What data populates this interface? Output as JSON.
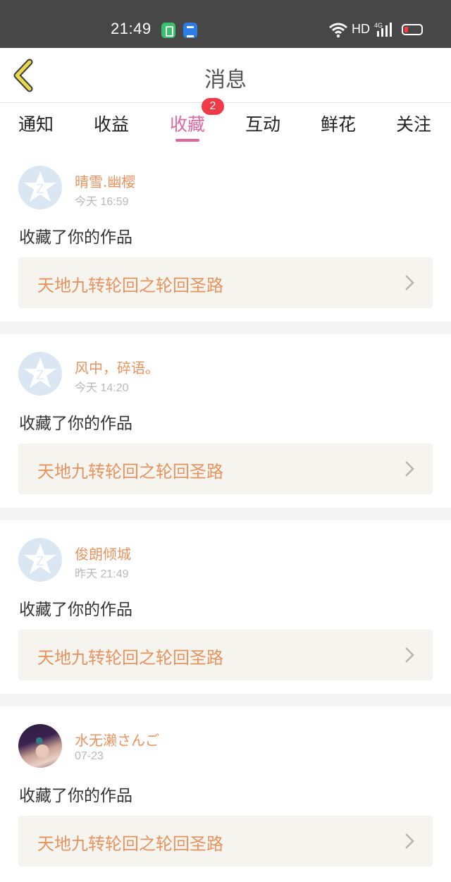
{
  "status_bar": {
    "time": "21:49",
    "network_label": "HD",
    "signal_label": "4G",
    "icons": [
      "app-green-icon",
      "app-blue-icon",
      "wifi-icon",
      "signal-icon",
      "battery-low-icon"
    ],
    "battery_color": "#ff3b3b"
  },
  "header": {
    "title": "消息",
    "back_icon": "chevron-left-icon",
    "back_icon_color": "#e8d84a"
  },
  "tabs": {
    "items": [
      {
        "label": "通知"
      },
      {
        "label": "收益"
      },
      {
        "label": "收藏",
        "active": true,
        "badge": "2"
      },
      {
        "label": "互动"
      },
      {
        "label": "鲜花"
      },
      {
        "label": "关注"
      }
    ],
    "active_color": "#e0679d",
    "badge_color": "#f03a47"
  },
  "feed": {
    "items": [
      {
        "username": "晴雪.幽樱",
        "time": "今天 16:59",
        "action": "收藏了你的作品",
        "work_title": "天地九转轮回之轮回圣路",
        "avatar": "default-avatar-icon"
      },
      {
        "username": "风中，碎语。",
        "time": "今天 14:20",
        "action": "收藏了你的作品",
        "work_title": "天地九转轮回之轮回圣路",
        "avatar": "default-avatar-icon"
      },
      {
        "username": "俊朗倾城",
        "time": "昨天 21:49",
        "action": "收藏了你的作品",
        "work_title": "天地九转轮回之轮回圣路",
        "avatar": "default-avatar-icon"
      },
      {
        "username": "水无濑さんご",
        "time": "07-23",
        "action": "收藏了你的作品",
        "work_title": "天地九转轮回之轮回圣路",
        "avatar": "user-photo-avatar"
      }
    ],
    "name_color": "#e8935f",
    "link_bg_color": "#f5f4ee"
  }
}
